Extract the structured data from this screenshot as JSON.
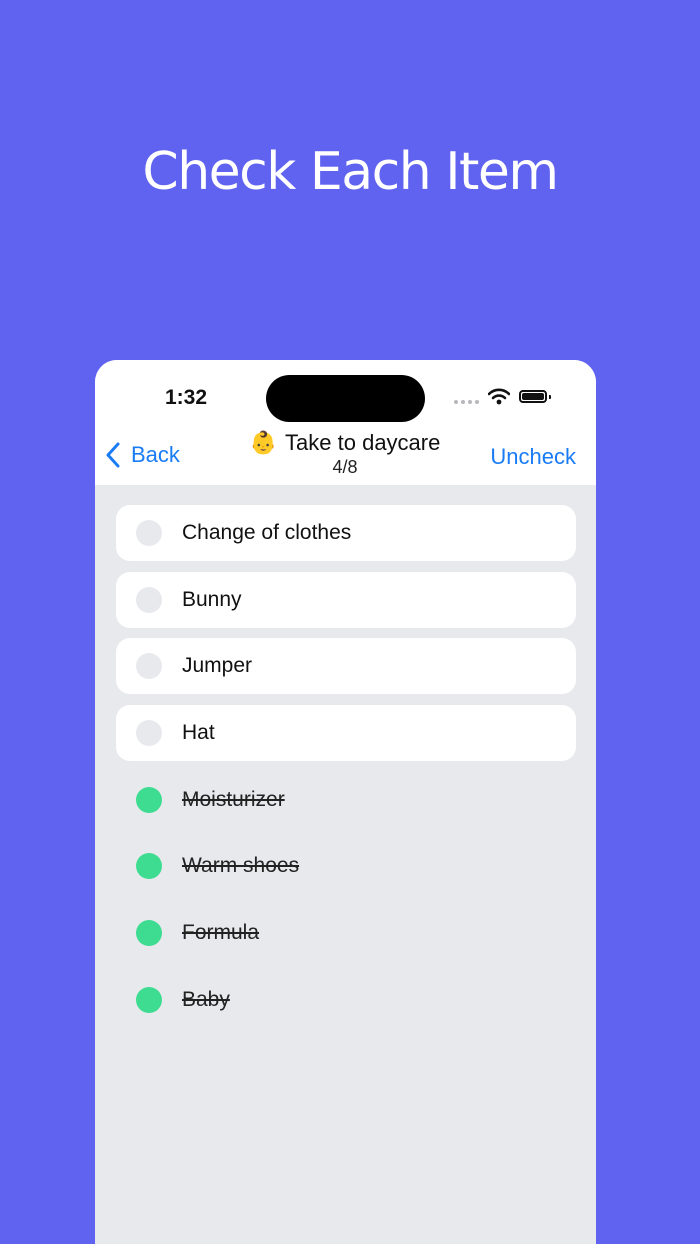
{
  "headline": "Check Each Item",
  "status_bar": {
    "time": "1:32"
  },
  "nav": {
    "back_label": "Back",
    "title_emoji": "👶",
    "title": "Take to daycare",
    "progress": "4/8",
    "action_label": "Uncheck"
  },
  "items": [
    {
      "label": "Change of clothes",
      "checked": false
    },
    {
      "label": "Bunny",
      "checked": false
    },
    {
      "label": "Jumper",
      "checked": false
    },
    {
      "label": "Hat",
      "checked": false
    },
    {
      "label": "Moisturizer",
      "checked": true
    },
    {
      "label": "Warm shoes",
      "checked": true
    },
    {
      "label": "Formula",
      "checked": true
    },
    {
      "label": "Baby",
      "checked": true
    }
  ],
  "colors": {
    "background": "#6063f0",
    "accent": "#1a7cf5",
    "checked": "#3ddc91"
  }
}
